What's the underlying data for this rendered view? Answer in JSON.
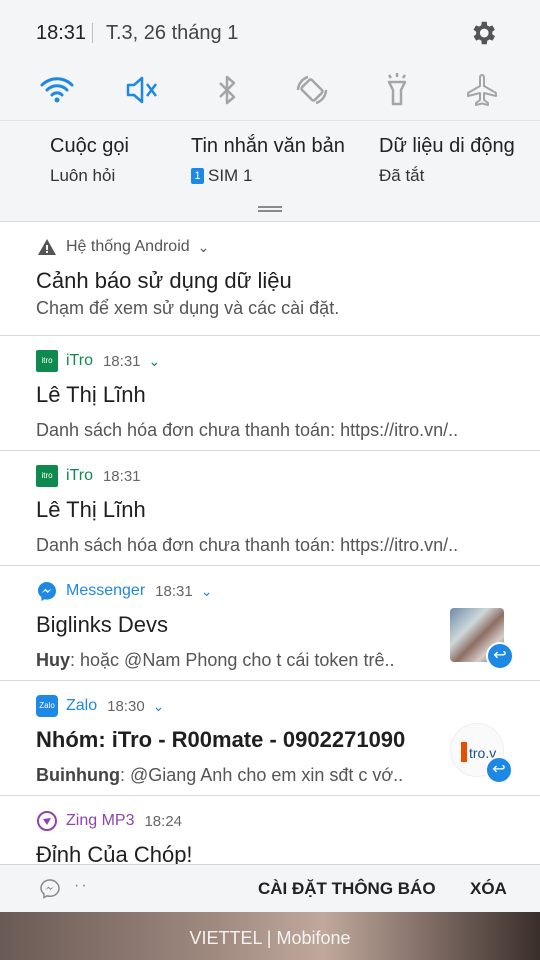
{
  "status": {
    "time": "18:31",
    "date": "T.3, 26 tháng 1"
  },
  "quick_settings": [
    "wifi-icon",
    "mute-icon",
    "bluetooth-icon",
    "auto-rotate-icon",
    "flashlight-icon",
    "airplane-icon"
  ],
  "modes": [
    {
      "title": "Cuộc gọi",
      "sub": "Luôn hỏi"
    },
    {
      "title": "Tin nhắn văn bản",
      "sim": "1",
      "sub": "SIM 1"
    },
    {
      "title": "Dữ liệu di động",
      "sub": "Đã tắt"
    }
  ],
  "notifications": [
    {
      "app": "Hệ thống Android",
      "time": "",
      "title": "Cảnh báo sử dụng dữ liệu",
      "text": "Chạm để xem sử dụng và các cài đặt."
    },
    {
      "app": "iTro",
      "time": "18:31",
      "title": "Lê Thị Lĩnh",
      "text": "Danh sách hóa đơn chưa thanh toán: https://itro.vn/.."
    },
    {
      "app": "iTro",
      "time": "18:31",
      "title": "Lê Thị Lĩnh",
      "text": "Danh sách hóa đơn chưa thanh toán: https://itro.vn/.."
    },
    {
      "app": "Messenger",
      "time": "18:31",
      "title": "Biglinks Devs",
      "sender": "Huy",
      "text": ": hoặc @Nam Phong cho t cái token trê.."
    },
    {
      "app": "Zalo",
      "time": "18:30",
      "title": "Nhóm: iTro - R00mate - 0902271090",
      "sender": "Buinhung",
      "text": ": @Giang Anh cho em xin sđt c vớ.."
    },
    {
      "app": "Zing MP3",
      "time": "18:24",
      "title": "Đỉnh Của Chóp!"
    }
  ],
  "colors": {
    "itro": "#0f8a4f",
    "messenger": "#1e88e5",
    "zing": "#8e44ad",
    "android": "#555555"
  },
  "bottom": {
    "settings": "CÀI ĐẶT THÔNG BÁO",
    "clear": "XÓA",
    "dots": "··"
  },
  "carrier": "VIETTEL | Mobifone"
}
